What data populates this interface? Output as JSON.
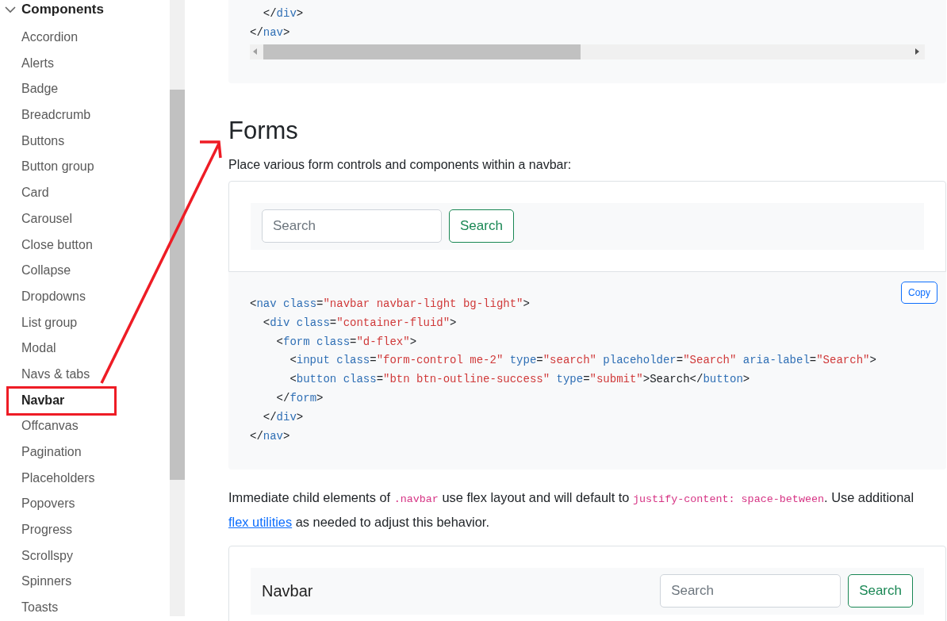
{
  "sidebar": {
    "section": {
      "label": "Components",
      "expanded": true
    },
    "items": [
      {
        "label": "Accordion",
        "selected": false
      },
      {
        "label": "Alerts",
        "selected": false
      },
      {
        "label": "Badge",
        "selected": false
      },
      {
        "label": "Breadcrumb",
        "selected": false
      },
      {
        "label": "Buttons",
        "selected": false
      },
      {
        "label": "Button group",
        "selected": false
      },
      {
        "label": "Card",
        "selected": false
      },
      {
        "label": "Carousel",
        "selected": false
      },
      {
        "label": "Close button",
        "selected": false
      },
      {
        "label": "Collapse",
        "selected": false
      },
      {
        "label": "Dropdowns",
        "selected": false
      },
      {
        "label": "List group",
        "selected": false
      },
      {
        "label": "Modal",
        "selected": false
      },
      {
        "label": "Navs & tabs",
        "selected": false
      },
      {
        "label": "Navbar",
        "selected": true
      },
      {
        "label": "Offcanvas",
        "selected": false
      },
      {
        "label": "Pagination",
        "selected": false
      },
      {
        "label": "Placeholders",
        "selected": false
      },
      {
        "label": "Popovers",
        "selected": false
      },
      {
        "label": "Progress",
        "selected": false
      },
      {
        "label": "Scrollspy",
        "selected": false
      },
      {
        "label": "Spinners",
        "selected": false
      },
      {
        "label": "Toasts",
        "selected": false
      }
    ]
  },
  "top_code": [
    [
      {
        "kind": "tag",
        "text": "  </"
      },
      {
        "kind": "name",
        "text": "div"
      },
      {
        "kind": "tag",
        "text": ">"
      }
    ],
    [
      {
        "kind": "tag",
        "text": "</"
      },
      {
        "kind": "name",
        "text": "nav"
      },
      {
        "kind": "tag",
        "text": ">"
      }
    ]
  ],
  "section": {
    "heading": "Forms",
    "intro": "Place various form controls and components within a navbar:",
    "example": {
      "placeholder": "Search",
      "button": "Search"
    },
    "copy_button": "Copy",
    "code": [
      [
        {
          "kind": "tag",
          "text": "<"
        },
        {
          "kind": "name",
          "text": "nav"
        },
        {
          "kind": "attr",
          "text": " class"
        },
        {
          "kind": "tag",
          "text": "="
        },
        {
          "kind": "str",
          "text": "\"navbar navbar-light bg-light\""
        },
        {
          "kind": "tag",
          "text": ">"
        }
      ],
      [
        {
          "kind": "tag",
          "text": "  <"
        },
        {
          "kind": "name",
          "text": "div"
        },
        {
          "kind": "attr",
          "text": " class"
        },
        {
          "kind": "tag",
          "text": "="
        },
        {
          "kind": "str",
          "text": "\"container-fluid\""
        },
        {
          "kind": "tag",
          "text": ">"
        }
      ],
      [
        {
          "kind": "tag",
          "text": "    <"
        },
        {
          "kind": "name",
          "text": "form"
        },
        {
          "kind": "attr",
          "text": " class"
        },
        {
          "kind": "tag",
          "text": "="
        },
        {
          "kind": "str",
          "text": "\"d-flex\""
        },
        {
          "kind": "tag",
          "text": ">"
        }
      ],
      [
        {
          "kind": "tag",
          "text": "      <"
        },
        {
          "kind": "name",
          "text": "input"
        },
        {
          "kind": "attr",
          "text": " class"
        },
        {
          "kind": "tag",
          "text": "="
        },
        {
          "kind": "str",
          "text": "\"form-control me-2\""
        },
        {
          "kind": "attr",
          "text": " type"
        },
        {
          "kind": "tag",
          "text": "="
        },
        {
          "kind": "str",
          "text": "\"search\""
        },
        {
          "kind": "attr",
          "text": " placeholder"
        },
        {
          "kind": "tag",
          "text": "="
        },
        {
          "kind": "str",
          "text": "\"Search\""
        },
        {
          "kind": "attr",
          "text": " aria-label"
        },
        {
          "kind": "tag",
          "text": "="
        },
        {
          "kind": "str",
          "text": "\"Search\""
        },
        {
          "kind": "tag",
          "text": ">"
        }
      ],
      [
        {
          "kind": "tag",
          "text": "      <"
        },
        {
          "kind": "name",
          "text": "button"
        },
        {
          "kind": "attr",
          "text": " class"
        },
        {
          "kind": "tag",
          "text": "="
        },
        {
          "kind": "str",
          "text": "\"btn btn-outline-success\""
        },
        {
          "kind": "attr",
          "text": " type"
        },
        {
          "kind": "tag",
          "text": "="
        },
        {
          "kind": "str",
          "text": "\"submit\""
        },
        {
          "kind": "tag",
          "text": ">"
        },
        {
          "kind": "text",
          "text": "Search"
        },
        {
          "kind": "tag",
          "text": "</"
        },
        {
          "kind": "name",
          "text": "button"
        },
        {
          "kind": "tag",
          "text": ">"
        }
      ],
      [
        {
          "kind": "tag",
          "text": "    </"
        },
        {
          "kind": "name",
          "text": "form"
        },
        {
          "kind": "tag",
          "text": ">"
        }
      ],
      [
        {
          "kind": "tag",
          "text": "  </"
        },
        {
          "kind": "name",
          "text": "div"
        },
        {
          "kind": "tag",
          "text": ">"
        }
      ],
      [
        {
          "kind": "tag",
          "text": "</"
        },
        {
          "kind": "name",
          "text": "nav"
        },
        {
          "kind": "tag",
          "text": ">"
        }
      ]
    ],
    "note": [
      {
        "kind": "text",
        "text": "Immediate child elements of "
      },
      {
        "kind": "code",
        "text": ".navbar"
      },
      {
        "kind": "text",
        "text": " use flex layout and will default to "
      },
      {
        "kind": "code",
        "text": "justify-content: space-between"
      },
      {
        "kind": "text",
        "text": ". Use additional "
      },
      {
        "kind": "link",
        "text": "flex utilities"
      },
      {
        "kind": "text",
        "text": " as needed to adjust this behavior."
      }
    ],
    "example2": {
      "brand": "Navbar",
      "placeholder": "Search",
      "button": "Search"
    }
  }
}
